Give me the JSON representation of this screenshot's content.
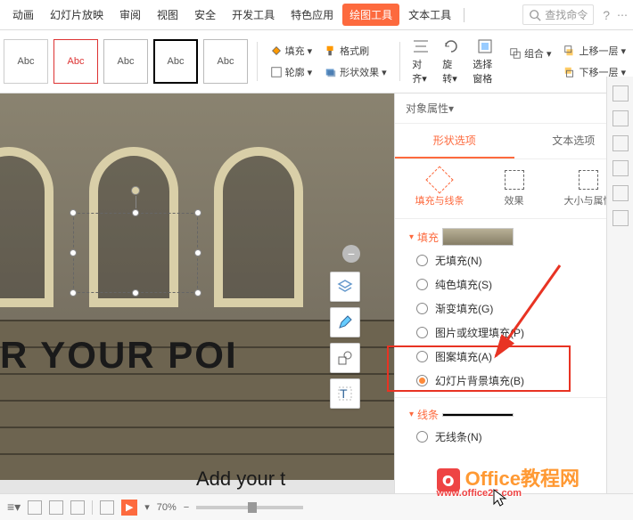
{
  "menu": {
    "tabs": [
      "动画",
      "幻灯片放映",
      "审阅",
      "视图",
      "安全",
      "开发工具",
      "特色应用",
      "绘图工具",
      "文本工具"
    ],
    "active": "绘图工具",
    "search_placeholder": "查找命令",
    "help": "?"
  },
  "ribbon": {
    "style_label": "Abc",
    "fill": "填充",
    "format_painter": "格式刷",
    "outline": "轮廓",
    "shape_effect": "形状效果",
    "align": "对齐",
    "rotate": "旋转",
    "select_pane": "选择窗格",
    "group": "组合",
    "move_up": "上移一层",
    "move_down": "下移一层"
  },
  "canvas": {
    "main_text": "ER YOUR POI",
    "sub_text": "Add your t"
  },
  "panel": {
    "title": "对象属性",
    "tabs": {
      "shape": "形状选项",
      "text": "文本选项"
    },
    "subtabs": {
      "fill_line": "填充与线条",
      "effect": "效果",
      "size_prop": "大小与属性"
    },
    "fill_section": "填充",
    "line_section": "线条",
    "fill_options": {
      "none": "无填充(N)",
      "solid": "纯色填充(S)",
      "gradient": "渐变填充(G)",
      "picture": "图片或纹理填充(P)",
      "pattern": "图案填充(A)",
      "slide_bg": "幻灯片背景填充(B)"
    },
    "line_none": "无线条(N)"
  },
  "bottom": {
    "zoom": "70%"
  },
  "watermark": {
    "brand": "Office教程网",
    "url": "www.office26.com"
  }
}
